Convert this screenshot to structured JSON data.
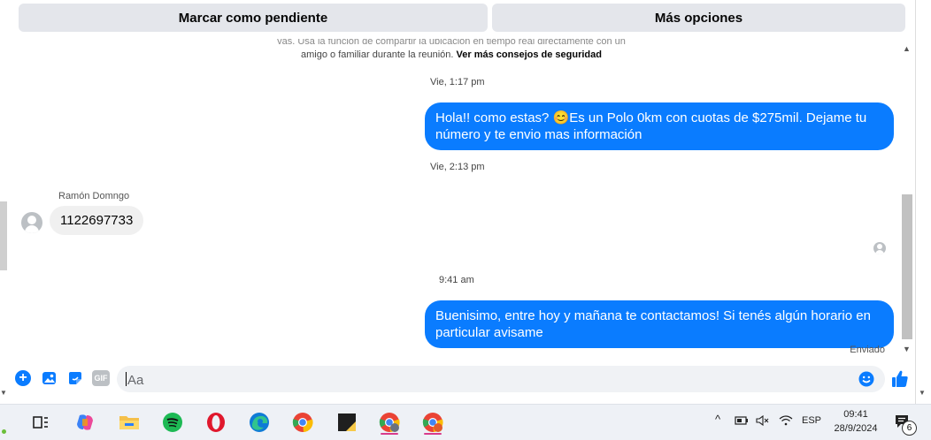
{
  "top_actions": {
    "mark_pending": "Marcar como pendiente",
    "more_options": "Más opciones"
  },
  "safety_notice": {
    "line1_partial": "vas. Usa la función de compartir la ubicación en tiempo real directamente con un",
    "line2": "amigo o familiar durante la reunión.",
    "link": "Ver más consejos de seguridad"
  },
  "messages": [
    {
      "timestamp": "Vie, 1:17 pm"
    },
    {
      "direction": "outgoing",
      "text_before_emoji": "Hola!! como estas? ",
      "emoji": "😊",
      "text_after_emoji": "Es un Polo 0km con cuotas de $275mil. Dejame tu número y te envio mas información"
    },
    {
      "timestamp": "Vie, 2:13 pm"
    },
    {
      "direction": "incoming",
      "sender": "Ramón Domngo",
      "text": "1122697733"
    },
    {
      "timestamp": "9:41 am"
    },
    {
      "direction": "outgoing",
      "text": "Buenisimo, entre hoy y mañana te contactamos! Si tenés algún horario en particular avisame",
      "status": "Enviado"
    }
  ],
  "composer": {
    "placeholder": "Aa",
    "gif_label": "GIF",
    "icons": [
      "plus-icon",
      "image-icon",
      "sticker-icon",
      "gif-icon",
      "emoji-icon",
      "like-icon"
    ]
  },
  "taskbar": {
    "apps": [
      "task-view",
      "copilot",
      "file-explorer",
      "spotify",
      "opera",
      "edge",
      "chrome",
      "sticky-notes",
      "chrome-profile-1",
      "chrome-profile-2"
    ],
    "language": "ESP",
    "time": "09:41",
    "date": "28/9/2024",
    "notification_count": "6"
  },
  "colors": {
    "outgoing_bubble": "#0a7cff",
    "incoming_bubble": "#f0f0f0",
    "button_bg": "#e4e6eb"
  }
}
